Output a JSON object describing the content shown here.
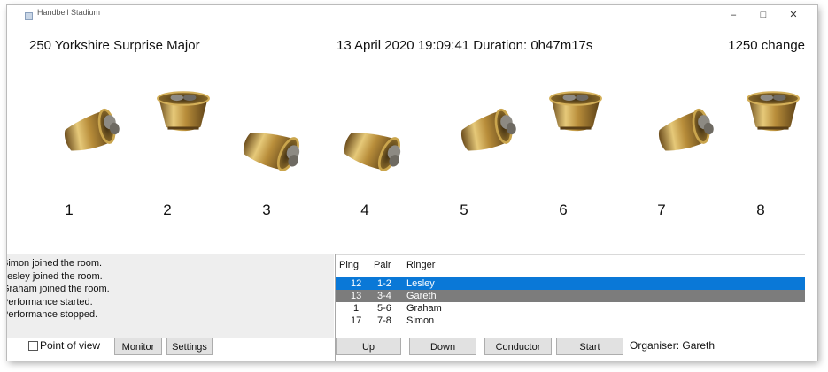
{
  "window": {
    "title": "Handbell Stadium",
    "minimize_glyph": "–",
    "maximize_glyph": "□",
    "close_glyph": "✕"
  },
  "header": {
    "method": "250 Yorkshire Surprise Major",
    "datetime": "13 April 2020  19:09:41  Duration: 0h47m17s",
    "changes": "1250 change"
  },
  "bells": {
    "numbers": [
      "1",
      "2",
      "3",
      "4",
      "5",
      "6",
      "7",
      "8"
    ],
    "colors": {
      "metal_light": "#e6c979",
      "metal_mid": "#b88d3a",
      "metal_dark": "#6b4c1c",
      "handle": "#6e6a62"
    }
  },
  "log": {
    "lines": [
      "Simon joined the room.",
      "Lesley joined the room.",
      "Graham joined the room.",
      "Performance started.",
      "Performance stopped."
    ]
  },
  "ringers": {
    "headers": {
      "ping": "Ping",
      "pair": "Pair",
      "ringer": "Ringer"
    },
    "rows": [
      {
        "ping": "12",
        "pair": "1-2",
        "ringer": "Lesley",
        "state": "selected"
      },
      {
        "ping": "13",
        "pair": "3-4",
        "ringer": "Gareth",
        "state": "inactive-selected"
      },
      {
        "ping": "1",
        "pair": "5-6",
        "ringer": "Graham",
        "state": "normal"
      },
      {
        "ping": "17",
        "pair": "7-8",
        "ringer": "Simon",
        "state": "normal"
      }
    ],
    "colors": {
      "selected": "#0a78d7",
      "inactive_selected": "#7c7c7c"
    }
  },
  "controls": {
    "point_of_view_label": "Point of view",
    "point_of_view_checked": false,
    "monitor_label": "Monitor",
    "settings_label": "Settings",
    "up_label": "Up",
    "down_label": "Down",
    "conductor_label": "Conductor",
    "start_label": "Start",
    "organiser": "Organiser: Gareth"
  }
}
